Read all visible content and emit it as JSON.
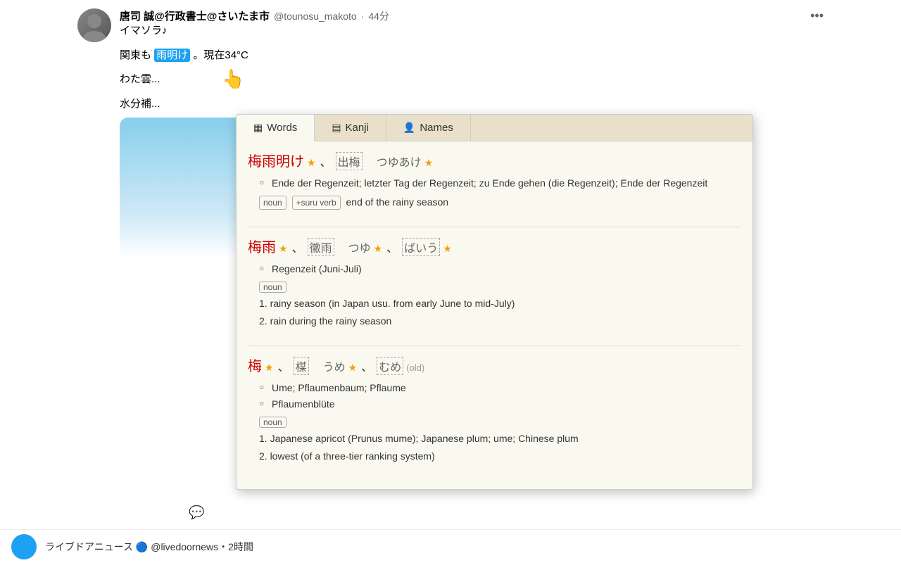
{
  "tweet": {
    "author": {
      "name": "唐司 誠@行政書士@さいたま市",
      "handle": "@tounosu_makoto",
      "time": "44分"
    },
    "lines": [
      "イマソラ♪",
      "",
      "関東も 雨明け。現在34°C",
      "",
      "わた雲...",
      "",
      "水分補..."
    ],
    "highlighted_word": "雨明け",
    "more_icon": "•••"
  },
  "dictionary": {
    "tabs": [
      {
        "id": "words",
        "label": "Words",
        "icon": "▦",
        "active": true
      },
      {
        "id": "kanji",
        "label": "Kanji",
        "icon": "▤",
        "active": false
      },
      {
        "id": "names",
        "label": "Names",
        "icon": "👤",
        "active": false
      }
    ],
    "entries": [
      {
        "id": "entry1",
        "kanji_parts": [
          "梅雨明け",
          "出梅"
        ],
        "readings": [
          "つゆあけ"
        ],
        "stars_main": [
          "★"
        ],
        "has_stars": true,
        "german": [
          "Ende der Regenzeit; letzter Tag der Regenzeit; zu Ende gehen (die Regenzeit); Ende der Regenzeit"
        ],
        "tags": [
          "noun",
          "+suru verb"
        ],
        "definitions": [
          "1. end of the rainy season"
        ]
      },
      {
        "id": "entry2",
        "kanji_parts": [
          "梅雨",
          "黴雨"
        ],
        "readings": [
          "つゆ",
          "ばいう"
        ],
        "has_stars": true,
        "german": [
          "Regenzeit (Juni-Juli)"
        ],
        "tags": [
          "noun"
        ],
        "definitions": [
          "1. rainy season (in Japan usu. from early June to mid-July)",
          "2. rain during the rainy season"
        ]
      },
      {
        "id": "entry3",
        "kanji_parts": [
          "梅",
          "楳"
        ],
        "readings": [
          "うめ",
          "むめ"
        ],
        "has_stars": true,
        "old_label": "(old)",
        "german": [
          "Ume; Pflaumenbaum; Pflaume",
          "Pflaumenblüte"
        ],
        "tags": [
          "noun"
        ],
        "definitions": [
          "1. Japanese apricot (Prunus mume); Japanese plum; ume; Chinese plum",
          "2. lowest (of a three-tier ranking system)"
        ]
      }
    ]
  },
  "bottom_tweet": {
    "handle": "@livedoornews",
    "time": "2時間"
  },
  "icons": {
    "words_icon": "▦",
    "kanji_icon": "▤",
    "names_icon": "👤",
    "comment_icon": "💬"
  }
}
